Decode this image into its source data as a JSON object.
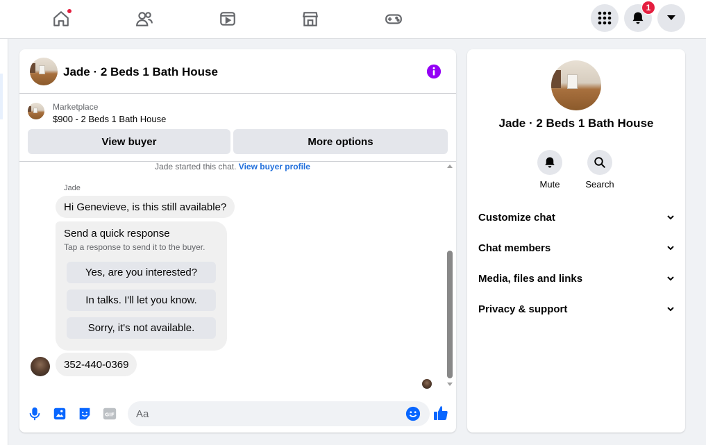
{
  "nav": {
    "tabs": [
      "home-icon",
      "friends-icon",
      "watch-icon",
      "marketplace-icon",
      "gaming-icon"
    ],
    "notifications_count": "1"
  },
  "chat": {
    "title": "Jade · 2 Beds 1 Bath House",
    "listing": {
      "source": "Marketplace",
      "price_title": "$900 - 2 Beds 1 Bath House",
      "view_buyer": "View buyer",
      "more_options": "More options"
    },
    "started_text": "Jade started this chat.",
    "view_buyer_profile": "View buyer profile",
    "sender_name": "Jade",
    "first_message": "Hi Genevieve, is this still available?",
    "quick": {
      "title": "Send a quick response",
      "subtitle": "Tap a response to send it to the buyer.",
      "options": [
        "Yes, are you interested?",
        "In talks. I'll let you know.",
        "Sorry, it's not available."
      ]
    },
    "phone_message": "352-440-0369",
    "composer_placeholder": "Aa"
  },
  "side": {
    "title": "Jade · 2 Beds 1 Bath House",
    "actions": [
      {
        "label": "Mute"
      },
      {
        "label": "Search"
      }
    ],
    "sections": [
      "Customize chat",
      "Chat members",
      "Media, files and links",
      "Privacy & support"
    ]
  },
  "colors": {
    "accent": "#0866ff",
    "info": "#9400f5",
    "badge": "#e41e3f"
  }
}
